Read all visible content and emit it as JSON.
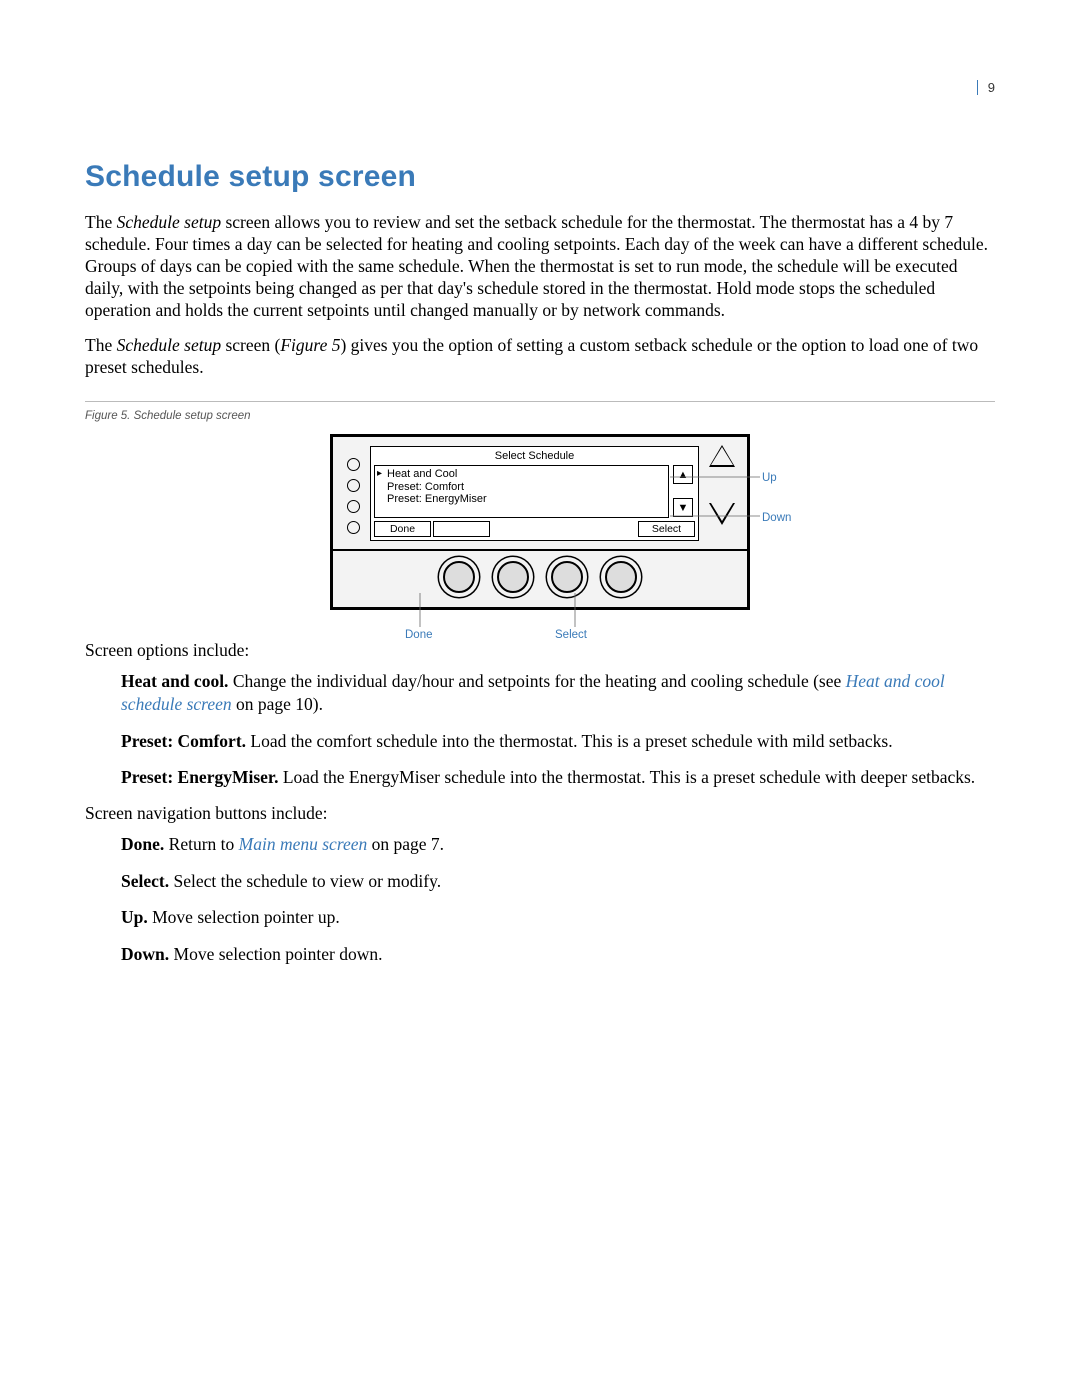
{
  "page_number": "9",
  "heading": "Schedule setup screen",
  "para1_a": "The ",
  "para1_b": "Schedule setup",
  "para1_c": " screen allows you to review and set the setback schedule for the thermostat. The thermostat has a 4 by 7 schedule. Four times a day can be selected for heating and cooling setpoints. Each day of the week can have a different schedule. Groups of days can be copied with the same schedule. When the thermostat is set to run mode, the schedule will be executed daily, with the setpoints being changed as per that day's schedule stored in the thermostat. Hold mode stops the scheduled operation and holds the current setpoints until changed manually or by network commands.",
  "para2_a": "The ",
  "para2_b": "Schedule setup",
  "para2_c": " screen (",
  "para2_d": "Figure 5",
  "para2_e": ") gives you the option of setting a custom setback schedule or the option to load one of two preset schedules.",
  "figure_caption": "Figure 5.    Schedule setup screen",
  "lcd": {
    "title": "Select Schedule",
    "items": [
      "Heat and Cool",
      "Preset: Comfort",
      "Preset: EnergyMiser"
    ],
    "soft_left": "Done",
    "soft_right": "Select"
  },
  "callouts": {
    "up": "Up",
    "down": "Down",
    "done": "Done",
    "select": "Select"
  },
  "options_intro": "Screen options include:",
  "opt1_b": "Heat and cool.",
  "opt1_t1": "  Change the individual day/hour and setpoints for the heating and cooling schedule (see ",
  "opt1_link": "Heat and cool schedule screen",
  "opt1_t2": " on page 10).",
  "opt2_b": "Preset: Comfort.",
  "opt2_t": "  Load the comfort schedule into the thermostat. This is a preset schedule with mild setbacks.",
  "opt3_b": "Preset: EnergyMiser.",
  "opt3_t": "  Load the EnergyMiser schedule into the thermostat. This is a preset schedule with deeper setbacks.",
  "nav_intro": "Screen navigation buttons include:",
  "nav1_b": "Done.",
  "nav1_t1": "  Return to ",
  "nav1_link": "Main menu screen",
  "nav1_t2": " on page 7.",
  "nav2_b": "Select.",
  "nav2_t": "  Select the schedule to view or modify.",
  "nav3_b": "Up.",
  "nav3_t": "  Move selection pointer up.",
  "nav4_b": "Down.",
  "nav4_t": "  Move selection pointer down."
}
